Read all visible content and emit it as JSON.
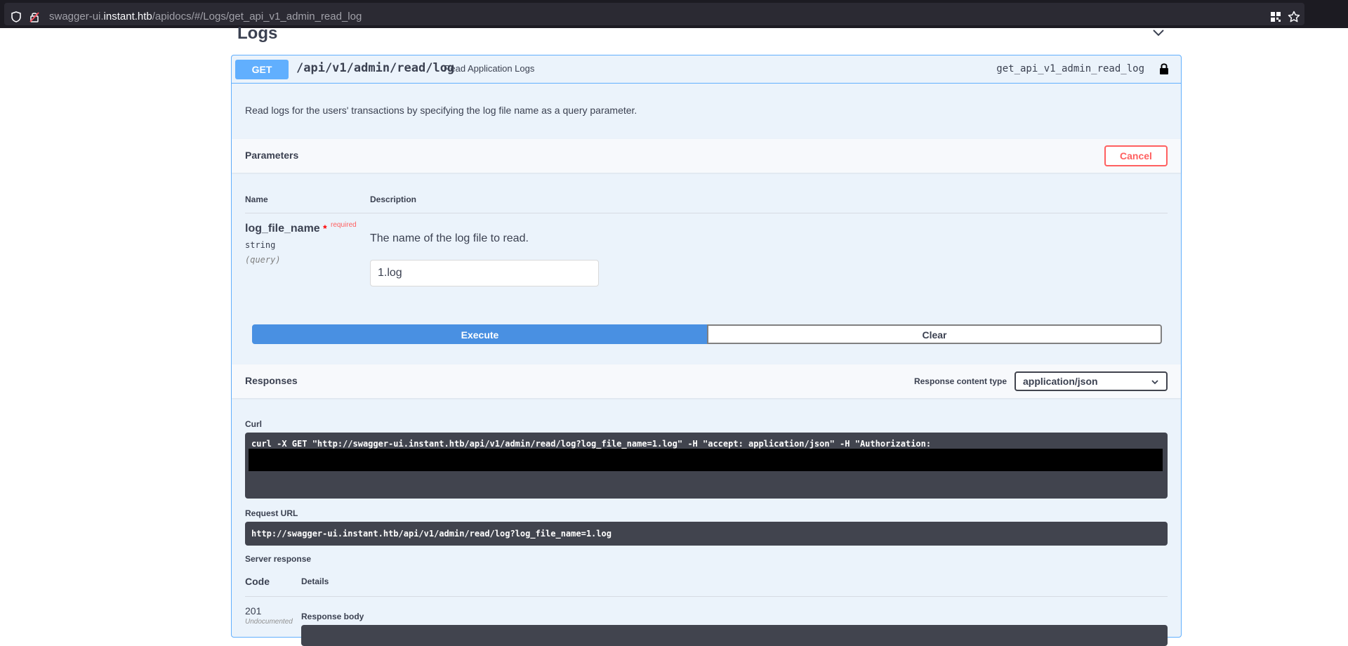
{
  "browser": {
    "url_prefix": "swagger-ui.",
    "url_domain": "instant.htb",
    "url_path": "/apidocs/#/Logs/get_api_v1_admin_read_log"
  },
  "section": {
    "title": "Logs"
  },
  "operation": {
    "method": "GET",
    "path": "/api/v1/admin/read/log",
    "summary": "Read Application Logs",
    "operation_id": "get_api_v1_admin_read_log",
    "description": "Read logs for the users' transactions by specifying the log file name as a query parameter."
  },
  "parameters": {
    "title": "Parameters",
    "cancel_label": "Cancel",
    "col_name": "Name",
    "col_description": "Description",
    "items": [
      {
        "name": "log_file_name",
        "star": "*",
        "required": "required",
        "type": "string",
        "in": "(query)",
        "description": "The name of the log file to read.",
        "value": "1.log"
      }
    ]
  },
  "actions": {
    "execute_label": "Execute",
    "clear_label": "Clear"
  },
  "responses": {
    "title": "Responses",
    "content_type_label": "Response content type",
    "content_type_value": "application/json",
    "curl_label": "Curl",
    "curl_command": "curl -X GET \"http://swagger-ui.instant.htb/api/v1/admin/read/log?log_file_name=1.log\" -H  \"accept: application/json\" -H  \"Authorization:",
    "request_url_label": "Request URL",
    "request_url": "http://swagger-ui.instant.htb/api/v1/admin/read/log?log_file_name=1.log",
    "server_response_label": "Server response",
    "col_code": "Code",
    "col_details": "Details",
    "code": "201",
    "code_note": "Undocumented",
    "body_label": "Response body"
  }
}
